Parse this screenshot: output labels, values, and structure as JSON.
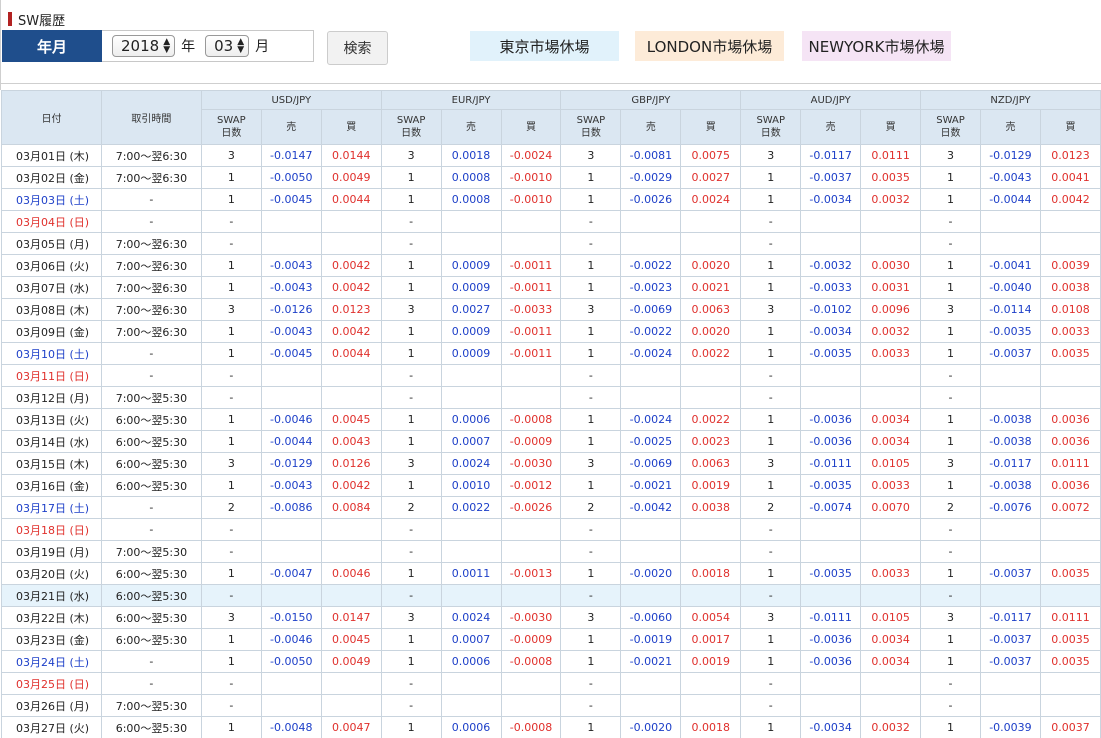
{
  "title": "SW履歴",
  "search": {
    "label": "年月",
    "year": "2018",
    "year_unit": "年",
    "month": "03",
    "month_unit": "月",
    "button": "検索"
  },
  "legend": {
    "tokyo": "東京市場休場",
    "london": "LONDON市場休場",
    "newyork": "NEWYORK市場休場"
  },
  "headers": {
    "date": "日付",
    "time": "取引時間",
    "pairs": [
      "USD/JPY",
      "EUR/JPY",
      "GBP/JPY",
      "AUD/JPY",
      "NZD/JPY"
    ],
    "swap_days_line1": "SWAP",
    "swap_days_line2": "日数",
    "sell": "売",
    "buy": "買"
  },
  "rows": [
    {
      "date": "03月01日 (木)",
      "day": "weekday",
      "time": "7:00〜翌6:30",
      "cells": [
        [
          "3",
          "-0.0147",
          "0.0144"
        ],
        [
          "3",
          "0.0018",
          "-0.0024"
        ],
        [
          "3",
          "-0.0081",
          "0.0075"
        ],
        [
          "3",
          "-0.0117",
          "0.0111"
        ],
        [
          "3",
          "-0.0129",
          "0.0123"
        ]
      ]
    },
    {
      "date": "03月02日 (金)",
      "day": "weekday",
      "time": "7:00〜翌6:30",
      "cells": [
        [
          "1",
          "-0.0050",
          "0.0049"
        ],
        [
          "1",
          "0.0008",
          "-0.0010"
        ],
        [
          "1",
          "-0.0029",
          "0.0027"
        ],
        [
          "1",
          "-0.0037",
          "0.0035"
        ],
        [
          "1",
          "-0.0043",
          "0.0041"
        ]
      ]
    },
    {
      "date": "03月03日 (土)",
      "day": "sat",
      "time": "-",
      "cells": [
        [
          "1",
          "-0.0045",
          "0.0044"
        ],
        [
          "1",
          "0.0008",
          "-0.0010"
        ],
        [
          "1",
          "-0.0026",
          "0.0024"
        ],
        [
          "1",
          "-0.0034",
          "0.0032"
        ],
        [
          "1",
          "-0.0044",
          "0.0042"
        ]
      ]
    },
    {
      "date": "03月04日 (日)",
      "day": "sun",
      "time": "-",
      "cells": [
        [
          "-",
          "",
          ""
        ],
        [
          "-",
          "",
          ""
        ],
        [
          "-",
          "",
          ""
        ],
        [
          "-",
          "",
          ""
        ],
        [
          "-",
          "",
          ""
        ]
      ]
    },
    {
      "date": "03月05日 (月)",
      "day": "weekday",
      "time": "7:00〜翌6:30",
      "cells": [
        [
          "-",
          "",
          ""
        ],
        [
          "-",
          "",
          ""
        ],
        [
          "-",
          "",
          ""
        ],
        [
          "-",
          "",
          ""
        ],
        [
          "-",
          "",
          ""
        ]
      ]
    },
    {
      "date": "03月06日 (火)",
      "day": "weekday",
      "time": "7:00〜翌6:30",
      "cells": [
        [
          "1",
          "-0.0043",
          "0.0042"
        ],
        [
          "1",
          "0.0009",
          "-0.0011"
        ],
        [
          "1",
          "-0.0022",
          "0.0020"
        ],
        [
          "1",
          "-0.0032",
          "0.0030"
        ],
        [
          "1",
          "-0.0041",
          "0.0039"
        ]
      ]
    },
    {
      "date": "03月07日 (水)",
      "day": "weekday",
      "time": "7:00〜翌6:30",
      "cells": [
        [
          "1",
          "-0.0043",
          "0.0042"
        ],
        [
          "1",
          "0.0009",
          "-0.0011"
        ],
        [
          "1",
          "-0.0023",
          "0.0021"
        ],
        [
          "1",
          "-0.0033",
          "0.0031"
        ],
        [
          "1",
          "-0.0040",
          "0.0038"
        ]
      ]
    },
    {
      "date": "03月08日 (木)",
      "day": "weekday",
      "time": "7:00〜翌6:30",
      "cells": [
        [
          "3",
          "-0.0126",
          "0.0123"
        ],
        [
          "3",
          "0.0027",
          "-0.0033"
        ],
        [
          "3",
          "-0.0069",
          "0.0063"
        ],
        [
          "3",
          "-0.0102",
          "0.0096"
        ],
        [
          "3",
          "-0.0114",
          "0.0108"
        ]
      ]
    },
    {
      "date": "03月09日 (金)",
      "day": "weekday",
      "time": "7:00〜翌6:30",
      "cells": [
        [
          "1",
          "-0.0043",
          "0.0042"
        ],
        [
          "1",
          "0.0009",
          "-0.0011"
        ],
        [
          "1",
          "-0.0022",
          "0.0020"
        ],
        [
          "1",
          "-0.0034",
          "0.0032"
        ],
        [
          "1",
          "-0.0035",
          "0.0033"
        ]
      ]
    },
    {
      "date": "03月10日 (土)",
      "day": "sat",
      "time": "-",
      "cells": [
        [
          "1",
          "-0.0045",
          "0.0044"
        ],
        [
          "1",
          "0.0009",
          "-0.0011"
        ],
        [
          "1",
          "-0.0024",
          "0.0022"
        ],
        [
          "1",
          "-0.0035",
          "0.0033"
        ],
        [
          "1",
          "-0.0037",
          "0.0035"
        ]
      ]
    },
    {
      "date": "03月11日 (日)",
      "day": "sun",
      "time": "-",
      "cells": [
        [
          "-",
          "",
          ""
        ],
        [
          "-",
          "",
          ""
        ],
        [
          "-",
          "",
          ""
        ],
        [
          "-",
          "",
          ""
        ],
        [
          "-",
          "",
          ""
        ]
      ]
    },
    {
      "date": "03月12日 (月)",
      "day": "weekday",
      "time": "7:00〜翌5:30",
      "cells": [
        [
          "-",
          "",
          ""
        ],
        [
          "-",
          "",
          ""
        ],
        [
          "-",
          "",
          ""
        ],
        [
          "-",
          "",
          ""
        ],
        [
          "-",
          "",
          ""
        ]
      ]
    },
    {
      "date": "03月13日 (火)",
      "day": "weekday",
      "time": "6:00〜翌5:30",
      "cells": [
        [
          "1",
          "-0.0046",
          "0.0045"
        ],
        [
          "1",
          "0.0006",
          "-0.0008"
        ],
        [
          "1",
          "-0.0024",
          "0.0022"
        ],
        [
          "1",
          "-0.0036",
          "0.0034"
        ],
        [
          "1",
          "-0.0038",
          "0.0036"
        ]
      ]
    },
    {
      "date": "03月14日 (水)",
      "day": "weekday",
      "time": "6:00〜翌5:30",
      "cells": [
        [
          "1",
          "-0.0044",
          "0.0043"
        ],
        [
          "1",
          "0.0007",
          "-0.0009"
        ],
        [
          "1",
          "-0.0025",
          "0.0023"
        ],
        [
          "1",
          "-0.0036",
          "0.0034"
        ],
        [
          "1",
          "-0.0038",
          "0.0036"
        ]
      ]
    },
    {
      "date": "03月15日 (木)",
      "day": "weekday",
      "time": "6:00〜翌5:30",
      "cells": [
        [
          "3",
          "-0.0129",
          "0.0126"
        ],
        [
          "3",
          "0.0024",
          "-0.0030"
        ],
        [
          "3",
          "-0.0069",
          "0.0063"
        ],
        [
          "3",
          "-0.0111",
          "0.0105"
        ],
        [
          "3",
          "-0.0117",
          "0.0111"
        ]
      ]
    },
    {
      "date": "03月16日 (金)",
      "day": "weekday",
      "time": "6:00〜翌5:30",
      "cells": [
        [
          "1",
          "-0.0043",
          "0.0042"
        ],
        [
          "1",
          "0.0010",
          "-0.0012"
        ],
        [
          "1",
          "-0.0021",
          "0.0019"
        ],
        [
          "1",
          "-0.0035",
          "0.0033"
        ],
        [
          "1",
          "-0.0038",
          "0.0036"
        ]
      ]
    },
    {
      "date": "03月17日 (土)",
      "day": "sat",
      "time": "-",
      "cells": [
        [
          "2",
          "-0.0086",
          "0.0084"
        ],
        [
          "2",
          "0.0022",
          "-0.0026"
        ],
        [
          "2",
          "-0.0042",
          "0.0038"
        ],
        [
          "2",
          "-0.0074",
          "0.0070"
        ],
        [
          "2",
          "-0.0076",
          "0.0072"
        ]
      ]
    },
    {
      "date": "03月18日 (日)",
      "day": "sun",
      "time": "-",
      "cells": [
        [
          "-",
          "",
          ""
        ],
        [
          "-",
          "",
          ""
        ],
        [
          "-",
          "",
          ""
        ],
        [
          "-",
          "",
          ""
        ],
        [
          "-",
          "",
          ""
        ]
      ]
    },
    {
      "date": "03月19日 (月)",
      "day": "weekday",
      "time": "7:00〜翌5:30",
      "cells": [
        [
          "-",
          "",
          ""
        ],
        [
          "-",
          "",
          ""
        ],
        [
          "-",
          "",
          ""
        ],
        [
          "-",
          "",
          ""
        ],
        [
          "-",
          "",
          ""
        ]
      ]
    },
    {
      "date": "03月20日 (火)",
      "day": "weekday",
      "time": "6:00〜翌5:30",
      "cells": [
        [
          "1",
          "-0.0047",
          "0.0046"
        ],
        [
          "1",
          "0.0011",
          "-0.0013"
        ],
        [
          "1",
          "-0.0020",
          "0.0018"
        ],
        [
          "1",
          "-0.0035",
          "0.0033"
        ],
        [
          "1",
          "-0.0037",
          "0.0035"
        ]
      ]
    },
    {
      "date": "03月21日 (水)",
      "day": "weekday",
      "tokyo": true,
      "time": "6:00〜翌5:30",
      "cells": [
        [
          "-",
          "",
          ""
        ],
        [
          "-",
          "",
          ""
        ],
        [
          "-",
          "",
          ""
        ],
        [
          "-",
          "",
          ""
        ],
        [
          "-",
          "",
          ""
        ]
      ]
    },
    {
      "date": "03月22日 (木)",
      "day": "weekday",
      "time": "6:00〜翌5:30",
      "cells": [
        [
          "3",
          "-0.0150",
          "0.0147"
        ],
        [
          "3",
          "0.0024",
          "-0.0030"
        ],
        [
          "3",
          "-0.0060",
          "0.0054"
        ],
        [
          "3",
          "-0.0111",
          "0.0105"
        ],
        [
          "3",
          "-0.0117",
          "0.0111"
        ]
      ]
    },
    {
      "date": "03月23日 (金)",
      "day": "weekday",
      "time": "6:00〜翌5:30",
      "cells": [
        [
          "1",
          "-0.0046",
          "0.0045"
        ],
        [
          "1",
          "0.0007",
          "-0.0009"
        ],
        [
          "1",
          "-0.0019",
          "0.0017"
        ],
        [
          "1",
          "-0.0036",
          "0.0034"
        ],
        [
          "1",
          "-0.0037",
          "0.0035"
        ]
      ]
    },
    {
      "date": "03月24日 (土)",
      "day": "sat",
      "time": "-",
      "cells": [
        [
          "1",
          "-0.0050",
          "0.0049"
        ],
        [
          "1",
          "0.0006",
          "-0.0008"
        ],
        [
          "1",
          "-0.0021",
          "0.0019"
        ],
        [
          "1",
          "-0.0036",
          "0.0034"
        ],
        [
          "1",
          "-0.0037",
          "0.0035"
        ]
      ]
    },
    {
      "date": "03月25日 (日)",
      "day": "sun",
      "time": "-",
      "cells": [
        [
          "-",
          "",
          ""
        ],
        [
          "-",
          "",
          ""
        ],
        [
          "-",
          "",
          ""
        ],
        [
          "-",
          "",
          ""
        ],
        [
          "-",
          "",
          ""
        ]
      ]
    },
    {
      "date": "03月26日 (月)",
      "day": "weekday",
      "time": "7:00〜翌5:30",
      "cells": [
        [
          "-",
          "",
          ""
        ],
        [
          "-",
          "",
          ""
        ],
        [
          "-",
          "",
          ""
        ],
        [
          "-",
          "",
          ""
        ],
        [
          "-",
          "",
          ""
        ]
      ]
    },
    {
      "date": "03月27日 (火)",
      "day": "weekday",
      "time": "6:00〜翌5:30",
      "cells": [
        [
          "1",
          "-0.0048",
          "0.0047"
        ],
        [
          "1",
          "0.0006",
          "-0.0008"
        ],
        [
          "1",
          "-0.0020",
          "0.0018"
        ],
        [
          "1",
          "-0.0034",
          "0.0032"
        ],
        [
          "1",
          "-0.0039",
          "0.0037"
        ]
      ]
    }
  ]
}
